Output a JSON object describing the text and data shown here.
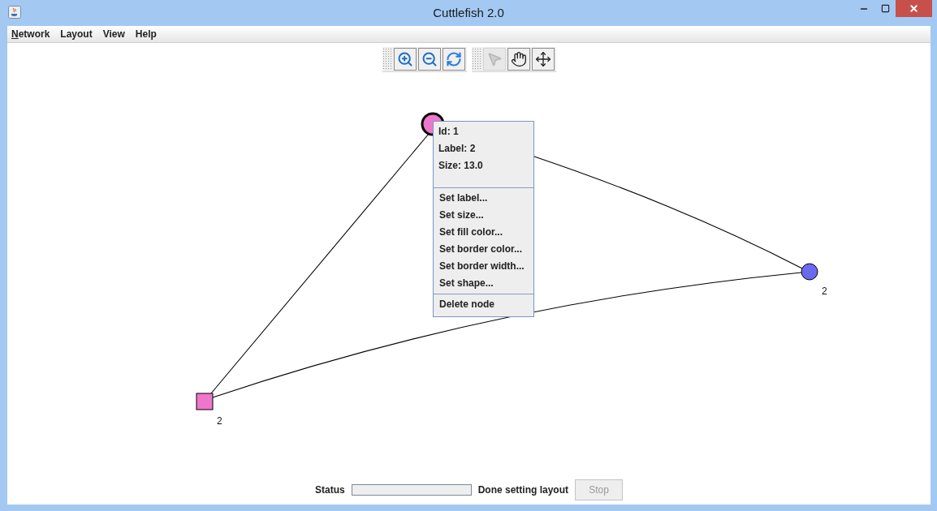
{
  "window": {
    "title": "Cuttlefish 2.0"
  },
  "menu": [
    {
      "label": "Network",
      "mnemonic": true
    },
    {
      "label": "Layout",
      "mnemonic": false
    },
    {
      "label": "View",
      "mnemonic": false
    },
    {
      "label": "Help",
      "mnemonic": false
    }
  ],
  "toolbar": {
    "groups": [
      {
        "buttons": [
          {
            "kind": "zoom-in",
            "disabled": false
          },
          {
            "kind": "zoom-out",
            "disabled": false
          },
          {
            "kind": "refresh",
            "disabled": false
          }
        ]
      },
      {
        "buttons": [
          {
            "kind": "select",
            "disabled": true
          },
          {
            "kind": "hand",
            "disabled": false
          },
          {
            "kind": "move",
            "disabled": false
          }
        ]
      }
    ]
  },
  "graph": {
    "nodes": [
      {
        "kind": "circle",
        "color": "#ee77cc",
        "selected": true
      },
      {
        "kind": "circle",
        "color": "#6a6af0",
        "selected": false,
        "label": "2"
      },
      {
        "kind": "square",
        "color": "#ee77cc",
        "selected": false,
        "label": "2"
      }
    ]
  },
  "context_menu": {
    "info": [
      "Id: 1",
      "Label: 2",
      "Size: 13.0"
    ],
    "groups": [
      [
        "Set label...",
        "Set size...",
        "Set fill color...",
        "Set border color...",
        "Set border width...",
        "Set shape..."
      ],
      [
        "Delete node"
      ]
    ]
  },
  "status_bar": {
    "label": "Status",
    "progress": {
      "level": 0
    },
    "message": "Done setting layout",
    "stop_button": {
      "label": "Stop",
      "disabled": true
    }
  }
}
